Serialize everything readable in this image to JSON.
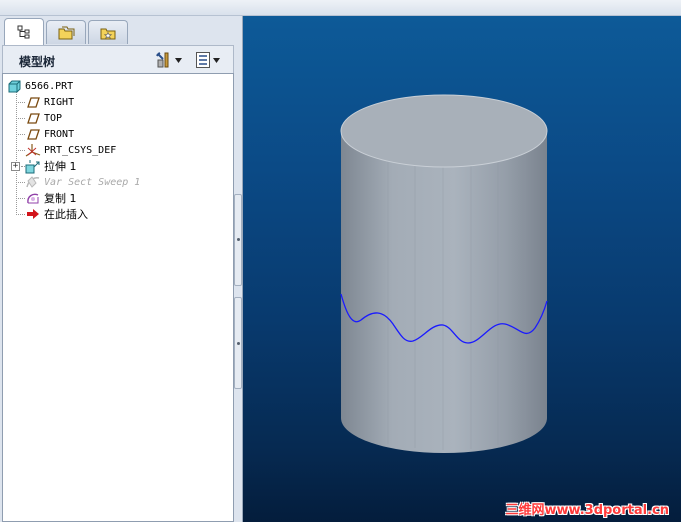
{
  "model_tree": {
    "title": "模型树",
    "root": "6566.PRT",
    "items": [
      {
        "label": "RIGHT",
        "icon": "datum-plane-icon"
      },
      {
        "label": "TOP",
        "icon": "datum-plane-icon"
      },
      {
        "label": "FRONT",
        "icon": "datum-plane-icon"
      },
      {
        "label": "PRT_CSYS_DEF",
        "icon": "csys-icon"
      },
      {
        "label": "拉伸 1",
        "icon": "extrude-icon"
      },
      {
        "label": "Var Sect Sweep 1",
        "icon": "sweep-icon"
      },
      {
        "label": "复制 1",
        "icon": "copy-feature-icon"
      },
      {
        "label": "在此插入",
        "icon": "insert-here-arrow-icon"
      }
    ]
  },
  "tabs": [
    {
      "icon": "model-tree-tab-icon"
    },
    {
      "icon": "folder-browser-tab-icon"
    },
    {
      "icon": "favorites-tab-icon"
    }
  ],
  "toolbar": {
    "settings_icon": "tree-settings-icon",
    "show_icon": "tree-show-icon"
  },
  "colors": {
    "cylinder": "#a7b0ba",
    "curve": "#1a1aff",
    "background_top": "#0d5a98",
    "background_bottom": "#041d3c"
  },
  "watermark": "三维网www.3dportal.cn"
}
